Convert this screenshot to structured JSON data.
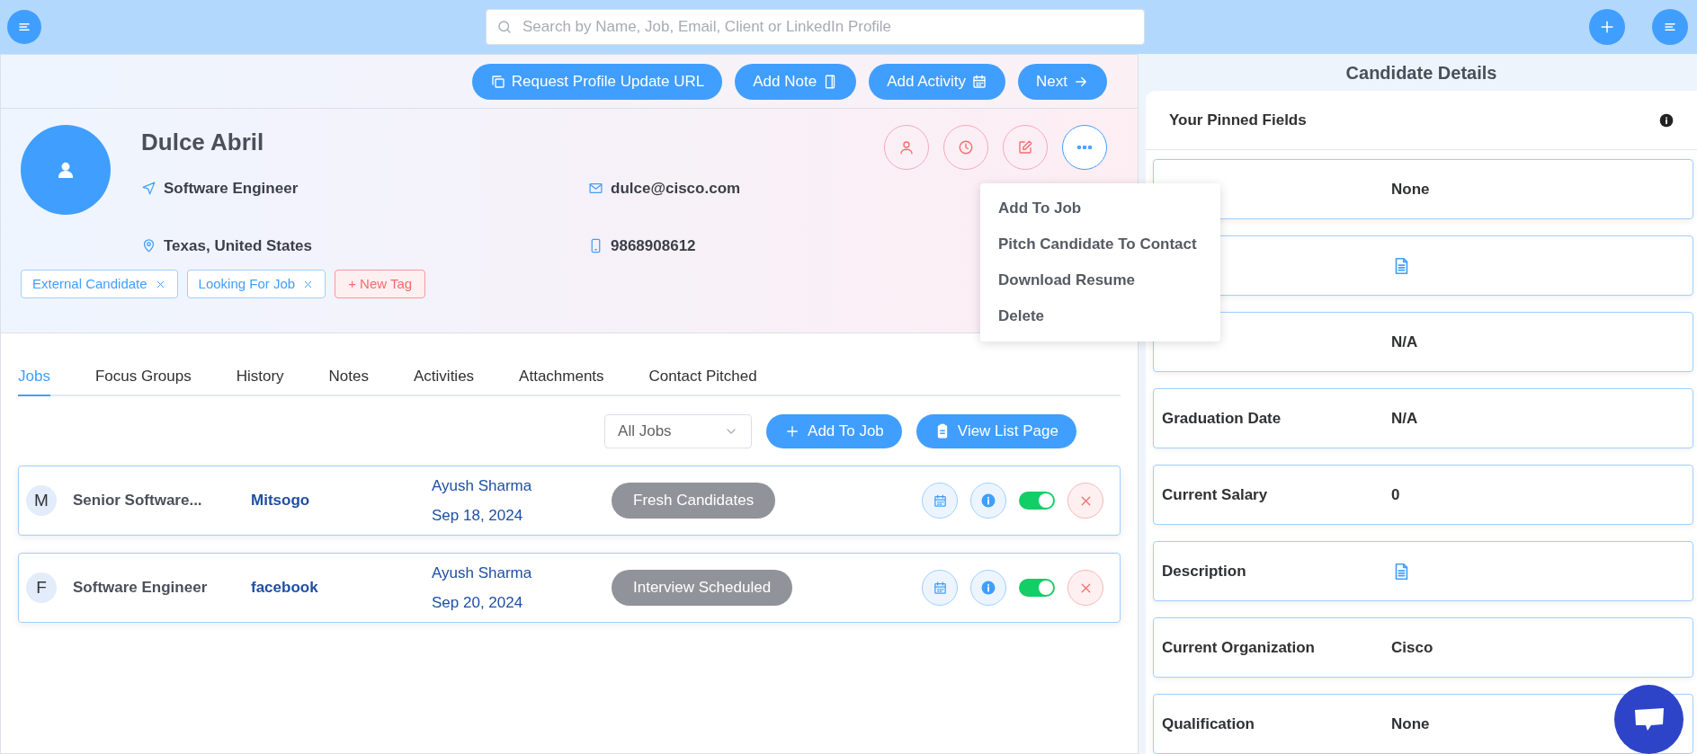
{
  "top_bar": {
    "search": {
      "placeholder": "Search by Name, Job, Email, Client or LinkedIn Profile"
    }
  },
  "header_buttons": [
    "Request Profile Update URL",
    "Add Note",
    "Add Activity",
    "Next"
  ],
  "profile": {
    "name": "Dulce Abril",
    "title": "Software Engineer",
    "email": "dulce@cisco.com",
    "location": "Texas, United States",
    "phone": "9868908612",
    "tags": [
      {
        "label": "External Candidate",
        "kind": "tag"
      },
      {
        "label": "Looking For Job",
        "kind": "tag"
      },
      {
        "label": "+ New Tag",
        "kind": "new"
      }
    ],
    "menu_open": true,
    "menu": [
      "Add To Job",
      "Pitch Candidate To Contact",
      "Download Resume",
      "Delete"
    ]
  },
  "tabs": [
    {
      "label": "Jobs",
      "selected": true
    },
    {
      "label": "Focus Groups",
      "selected": false
    },
    {
      "label": "History",
      "selected": false
    },
    {
      "label": "Notes",
      "selected": false
    },
    {
      "label": "Activities",
      "selected": false
    },
    {
      "label": "Attachments",
      "selected": false
    },
    {
      "label": "Contact Pitched",
      "selected": false
    }
  ],
  "jobs_toolbar": {
    "filter": "All Jobs",
    "buttons": [
      "Add To Job",
      "View List Page"
    ]
  },
  "jobs": [
    {
      "initial": "M",
      "title": "Senior Software...",
      "company": "Mitsogo",
      "owner": "Ayush Sharma",
      "date": "Sep 18, 2024",
      "stage": "Fresh Candidates",
      "active": true
    },
    {
      "initial": "F",
      "title": "Software Engineer",
      "company": "facebook",
      "owner": "Ayush Sharma",
      "date": "Sep 20, 2024",
      "stage": "Interview Scheduled",
      "active": true
    }
  ],
  "candidate_details": {
    "title": "Candidate Details",
    "pinned_title": "Your Pinned Fields",
    "fields": [
      {
        "kind": "text",
        "value": "None"
      },
      {
        "kind": "doc"
      },
      {
        "kind": "text",
        "value": "N/A"
      },
      {
        "kind": "text",
        "label": "Graduation Date",
        "value": "N/A"
      },
      {
        "kind": "text",
        "label": "Current Salary",
        "value": "0"
      },
      {
        "kind": "doc",
        "label": "Description"
      },
      {
        "kind": "text",
        "label": "Current Organization",
        "value": "Cisco"
      },
      {
        "kind": "text",
        "label": "Qualification",
        "value": "None"
      }
    ]
  }
}
